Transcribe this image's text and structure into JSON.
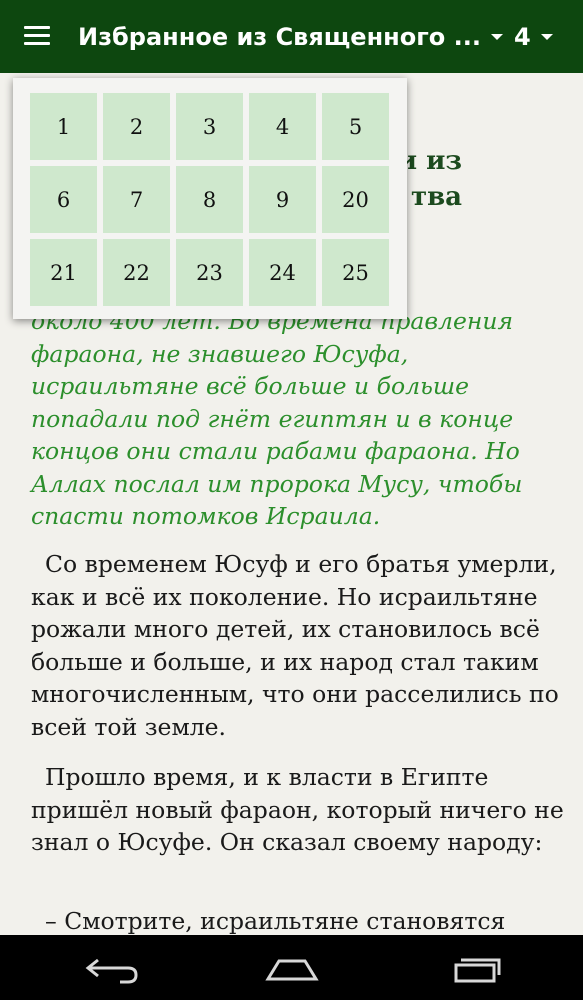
{
  "app_bar": {
    "title": "Избранное из Священного ...",
    "chapter": "4"
  },
  "dropdown": {
    "chapters": [
      "1",
      "2",
      "3",
      "4",
      "5",
      "6",
      "7",
      "8",
      "9",
      "20",
      "21",
      "22",
      "23",
      "24",
      "25"
    ]
  },
  "content": {
    "heading": "и из\nтва",
    "intro": "ахиму,\n в Египте\nоколо 400 лет. Во времена правления\nфараона, не знавшего Юсуфа,\nисраильтяне всё больше и больше\nпопадали под гнёт египтян и в конце\nконцов они стали рабами фараона. Но\nАллах послал им пророка Мусу, чтобы\nспасти потомков Исраила.",
    "paragraphs": [
      "Со временем Юсуф и его братья умерли, как и всё их поколение. Но исраильтяне рожали много детей, их становилось всё больше и больше, и их народ стал таким многочисленным, что они расселились по всей той земле.",
      "Прошло время, и к власти в Египте пришёл новый фараон, который ничего не знал о Юсуфе. Он сказал своему народу:",
      "– Смотрите, исраильтяне становятся"
    ]
  },
  "icons": {
    "menu": "hamburger-icon",
    "back": "back-icon",
    "home": "home-icon",
    "recents": "recents-icon"
  },
  "colors": {
    "app_bar": "#0d470f",
    "grid_cell": "#cfe8cd",
    "intro_text": "#2c8f2c",
    "background": "#f2f1ec"
  }
}
